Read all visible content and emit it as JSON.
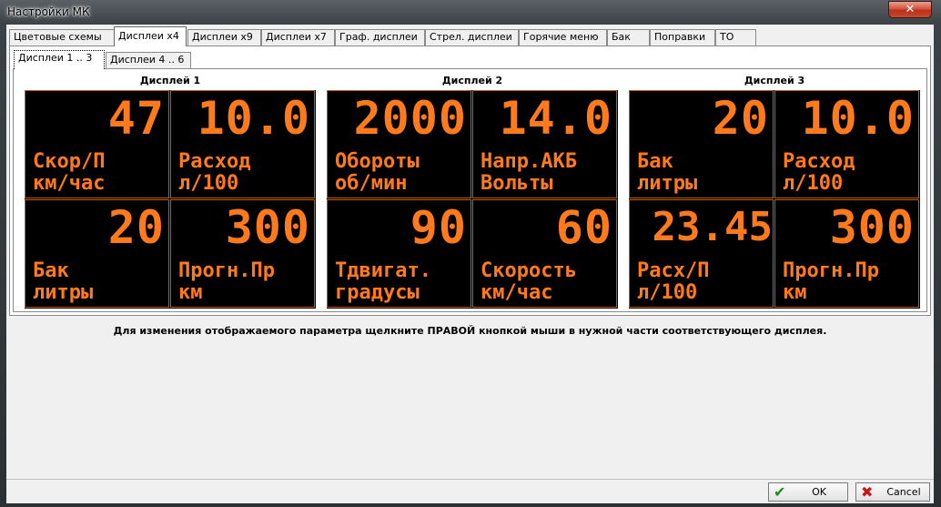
{
  "window": {
    "title": "Настройки МК",
    "close_label": "✕"
  },
  "tabs": [
    "Цветовые схемы",
    "Дисплеи x4",
    "Дисплеи x9",
    "Дисплеи x7",
    "Граф. дисплеи",
    "Стрел. дисплеи",
    "Горячие меню",
    "Бак",
    "Поправки",
    "ТО"
  ],
  "subtabs": [
    "Дисплеи 1 .. 3",
    "Дисплеи 4 .. 6"
  ],
  "displays": [
    {
      "label": "Дисплей 1",
      "cells": [
        {
          "value": "47",
          "line1": "Скор/П",
          "line2": "км/час"
        },
        {
          "value": "10.0",
          "line1": "Расход",
          "line2": "л/100"
        },
        {
          "value": "20",
          "line1": "Бак",
          "line2": "литры"
        },
        {
          "value": "300",
          "line1": "Прогн.Пр",
          "line2": "км"
        }
      ]
    },
    {
      "label": "Дисплей 2",
      "cells": [
        {
          "value": "2000",
          "line1": "Обороты",
          "line2": "об/мин"
        },
        {
          "value": "14.0",
          "line1": "Напр.АКБ",
          "line2": "Вольты"
        },
        {
          "value": "90",
          "line1": "Тдвигат.",
          "line2": "градусы"
        },
        {
          "value": "60",
          "line1": "Скорость",
          "line2": "км/час"
        }
      ]
    },
    {
      "label": "Дисплей 3",
      "cells": [
        {
          "value": "20",
          "line1": "Бак",
          "line2": "литры"
        },
        {
          "value": "10.0",
          "line1": "Расход",
          "line2": "л/100"
        },
        {
          "value": "23.45",
          "line1": "Расх/П",
          "line2": "л/100"
        },
        {
          "value": "300",
          "line1": "Прогн.Пр",
          "line2": "км"
        }
      ]
    }
  ],
  "hint": "Для изменения отображаемого параметра щелкните ПРАВОЙ кнопкой мыши в нужной части соответствующего дисплея.",
  "buttons": {
    "ok_label": "OK",
    "ok_icon": "✔",
    "cancel_label": "Cancel",
    "cancel_icon": "✖"
  },
  "colors": {
    "display_text": "#ff7a1c",
    "display_bg": "#000000",
    "ok_icon": "#1c8a1c",
    "cancel_icon": "#c81414"
  }
}
